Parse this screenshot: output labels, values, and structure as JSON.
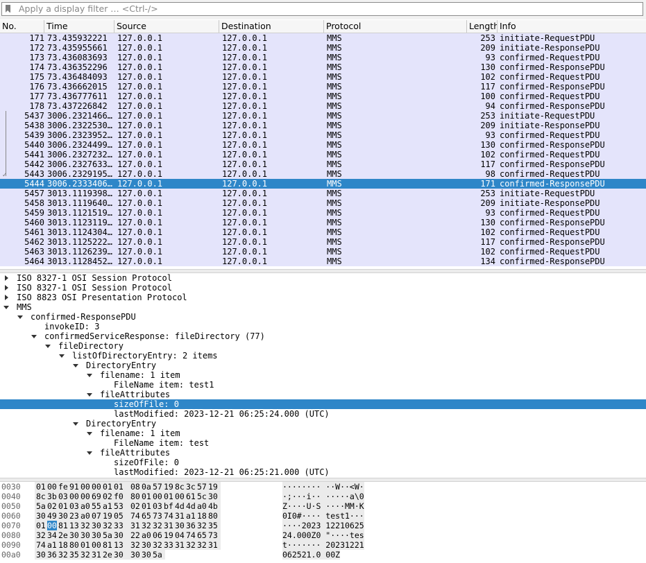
{
  "filter": {
    "placeholder": "Apply a display filter … <Ctrl-/>"
  },
  "columns": [
    "No.",
    "Time",
    "Source",
    "Destination",
    "Protocol",
    "Length",
    "Info"
  ],
  "packets": [
    {
      "no": "171",
      "time": "73.435932221",
      "src": "127.0.0.1",
      "dst": "127.0.0.1",
      "proto": "MMS",
      "len": "253",
      "info": "initiate-RequestPDU"
    },
    {
      "no": "172",
      "time": "73.435955661",
      "src": "127.0.0.1",
      "dst": "127.0.0.1",
      "proto": "MMS",
      "len": "209",
      "info": "initiate-ResponsePDU"
    },
    {
      "no": "173",
      "time": "73.436083693",
      "src": "127.0.0.1",
      "dst": "127.0.0.1",
      "proto": "MMS",
      "len": "93",
      "info": "confirmed-RequestPDU"
    },
    {
      "no": "174",
      "time": "73.436352296",
      "src": "127.0.0.1",
      "dst": "127.0.0.1",
      "proto": "MMS",
      "len": "130",
      "info": "confirmed-ResponsePDU"
    },
    {
      "no": "175",
      "time": "73.436484093",
      "src": "127.0.0.1",
      "dst": "127.0.0.1",
      "proto": "MMS",
      "len": "102",
      "info": "confirmed-RequestPDU"
    },
    {
      "no": "176",
      "time": "73.436662015",
      "src": "127.0.0.1",
      "dst": "127.0.0.1",
      "proto": "MMS",
      "len": "117",
      "info": "confirmed-ResponsePDU"
    },
    {
      "no": "177",
      "time": "73.436777611",
      "src": "127.0.0.1",
      "dst": "127.0.0.1",
      "proto": "MMS",
      "len": "100",
      "info": "confirmed-RequestPDU"
    },
    {
      "no": "178",
      "time": "73.437226842",
      "src": "127.0.0.1",
      "dst": "127.0.0.1",
      "proto": "MMS",
      "len": "94",
      "info": "confirmed-ResponsePDU"
    },
    {
      "no": "5437",
      "time": "3006.2321466…",
      "src": "127.0.0.1",
      "dst": "127.0.0.1",
      "proto": "MMS",
      "len": "253",
      "info": "initiate-RequestPDU"
    },
    {
      "no": "5438",
      "time": "3006.2322530…",
      "src": "127.0.0.1",
      "dst": "127.0.0.1",
      "proto": "MMS",
      "len": "209",
      "info": "initiate-ResponsePDU"
    },
    {
      "no": "5439",
      "time": "3006.2323952…",
      "src": "127.0.0.1",
      "dst": "127.0.0.1",
      "proto": "MMS",
      "len": "93",
      "info": "confirmed-RequestPDU"
    },
    {
      "no": "5440",
      "time": "3006.2324499…",
      "src": "127.0.0.1",
      "dst": "127.0.0.1",
      "proto": "MMS",
      "len": "130",
      "info": "confirmed-ResponsePDU"
    },
    {
      "no": "5441",
      "time": "3006.2327232…",
      "src": "127.0.0.1",
      "dst": "127.0.0.1",
      "proto": "MMS",
      "len": "102",
      "info": "confirmed-RequestPDU"
    },
    {
      "no": "5442",
      "time": "3006.2327633…",
      "src": "127.0.0.1",
      "dst": "127.0.0.1",
      "proto": "MMS",
      "len": "117",
      "info": "confirmed-ResponsePDU"
    },
    {
      "no": "5443",
      "time": "3006.2329195…",
      "src": "127.0.0.1",
      "dst": "127.0.0.1",
      "proto": "MMS",
      "len": "98",
      "info": "confirmed-RequestPDU"
    },
    {
      "no": "5444",
      "time": "3006.2333406…",
      "src": "127.0.0.1",
      "dst": "127.0.0.1",
      "proto": "MMS",
      "len": "171",
      "info": "confirmed-ResponsePDU",
      "selected": true
    },
    {
      "no": "5457",
      "time": "3013.1119398…",
      "src": "127.0.0.1",
      "dst": "127.0.0.1",
      "proto": "MMS",
      "len": "253",
      "info": "initiate-RequestPDU"
    },
    {
      "no": "5458",
      "time": "3013.1119640…",
      "src": "127.0.0.1",
      "dst": "127.0.0.1",
      "proto": "MMS",
      "len": "209",
      "info": "initiate-ResponsePDU"
    },
    {
      "no": "5459",
      "time": "3013.1121519…",
      "src": "127.0.0.1",
      "dst": "127.0.0.1",
      "proto": "MMS",
      "len": "93",
      "info": "confirmed-RequestPDU"
    },
    {
      "no": "5460",
      "time": "3013.1123119…",
      "src": "127.0.0.1",
      "dst": "127.0.0.1",
      "proto": "MMS",
      "len": "130",
      "info": "confirmed-ResponsePDU"
    },
    {
      "no": "5461",
      "time": "3013.1124304…",
      "src": "127.0.0.1",
      "dst": "127.0.0.1",
      "proto": "MMS",
      "len": "102",
      "info": "confirmed-RequestPDU"
    },
    {
      "no": "5462",
      "time": "3013.1125222…",
      "src": "127.0.0.1",
      "dst": "127.0.0.1",
      "proto": "MMS",
      "len": "117",
      "info": "confirmed-ResponsePDU"
    },
    {
      "no": "5463",
      "time": "3013.1126239…",
      "src": "127.0.0.1",
      "dst": "127.0.0.1",
      "proto": "MMS",
      "len": "102",
      "info": "confirmed-RequestPDU"
    },
    {
      "no": "5464",
      "time": "3013.1128452…",
      "src": "127.0.0.1",
      "dst": "127.0.0.1",
      "proto": "MMS",
      "len": "134",
      "info": "confirmed-ResponsePDU"
    }
  ],
  "details": [
    {
      "text": "ISO 8327-1 OSI Session Protocol",
      "level": 0,
      "toggle": "closed"
    },
    {
      "text": "ISO 8327-1 OSI Session Protocol",
      "level": 0,
      "toggle": "closed"
    },
    {
      "text": "ISO 8823 OSI Presentation Protocol",
      "level": 0,
      "toggle": "closed"
    },
    {
      "text": "MMS",
      "level": 0,
      "toggle": "open"
    },
    {
      "text": "confirmed-ResponsePDU",
      "level": 1,
      "toggle": "open"
    },
    {
      "text": "invokeID: 3",
      "level": 2,
      "toggle": "none"
    },
    {
      "text": "confirmedServiceResponse: fileDirectory (77)",
      "level": 2,
      "toggle": "open"
    },
    {
      "text": "fileDirectory",
      "level": 3,
      "toggle": "open"
    },
    {
      "text": "listOfDirectoryEntry: 2 items",
      "level": 4,
      "toggle": "open"
    },
    {
      "text": "DirectoryEntry",
      "level": 5,
      "toggle": "open"
    },
    {
      "text": "filename: 1 item",
      "level": 6,
      "toggle": "open"
    },
    {
      "text": "FileName item: test1",
      "level": 7,
      "toggle": "none"
    },
    {
      "text": "fileAttributes",
      "level": 6,
      "toggle": "open"
    },
    {
      "text": "sizeOfFile: 0",
      "level": 7,
      "toggle": "none",
      "selected": true
    },
    {
      "text": "lastModified: 2023-12-21 06:25:24.000 (UTC)",
      "level": 7,
      "toggle": "none"
    },
    {
      "text": "DirectoryEntry",
      "level": 5,
      "toggle": "open"
    },
    {
      "text": "filename: 1 item",
      "level": 6,
      "toggle": "open"
    },
    {
      "text": "FileName item: test",
      "level": 7,
      "toggle": "none"
    },
    {
      "text": "fileAttributes",
      "level": 6,
      "toggle": "open"
    },
    {
      "text": "sizeOfFile: 0",
      "level": 7,
      "toggle": "none"
    },
    {
      "text": "lastModified: 2023-12-21 06:25:21.000 (UTC)",
      "level": 7,
      "toggle": "none"
    }
  ],
  "bytes": [
    {
      "offset": "0030",
      "hex": [
        "01",
        "00",
        "fe",
        "91",
        "00",
        "00",
        "01",
        "01",
        "08",
        "0a",
        "57",
        "19",
        "8c",
        "3c",
        "57",
        "19"
      ],
      "ascii": "········ ··W··<W·"
    },
    {
      "offset": "0040",
      "hex": [
        "8c",
        "3b",
        "03",
        "00",
        "00",
        "69",
        "02",
        "f0",
        "80",
        "01",
        "00",
        "01",
        "00",
        "61",
        "5c",
        "30"
      ],
      "ascii": "·;···i·· ·····a\\0"
    },
    {
      "offset": "0050",
      "hex": [
        "5a",
        "02",
        "01",
        "03",
        "a0",
        "55",
        "a1",
        "53",
        "02",
        "01",
        "03",
        "bf",
        "4d",
        "4d",
        "a0",
        "4b"
      ],
      "ascii": "Z····U·S ····MM·K"
    },
    {
      "offset": "0060",
      "hex": [
        "30",
        "49",
        "30",
        "23",
        "a0",
        "07",
        "19",
        "05",
        "74",
        "65",
        "73",
        "74",
        "31",
        "a1",
        "18",
        "80"
      ],
      "ascii": "0I0#···· test1···"
    },
    {
      "offset": "0070",
      "hex": [
        "01",
        "00",
        "81",
        "13",
        "32",
        "30",
        "32",
        "33",
        "31",
        "32",
        "32",
        "31",
        "30",
        "36",
        "32",
        "35"
      ],
      "ascii": "····2023 12210625",
      "hl": 1
    },
    {
      "offset": "0080",
      "hex": [
        "32",
        "34",
        "2e",
        "30",
        "30",
        "30",
        "5a",
        "30",
        "22",
        "a0",
        "06",
        "19",
        "04",
        "74",
        "65",
        "73"
      ],
      "ascii": "24.000Z0 \"····tes"
    },
    {
      "offset": "0090",
      "hex": [
        "74",
        "a1",
        "18",
        "80",
        "01",
        "00",
        "81",
        "13",
        "32",
        "30",
        "32",
        "33",
        "31",
        "32",
        "32",
        "31"
      ],
      "ascii": "t······· 20231221"
    },
    {
      "offset": "00a0",
      "hex": [
        "30",
        "36",
        "32",
        "35",
        "32",
        "31",
        "2e",
        "30",
        "30",
        "30",
        "5a"
      ],
      "ascii": "062521.0 00Z"
    }
  ],
  "colors": {
    "selection": "#2e86c8",
    "row_bg": "#e4e4fb"
  }
}
